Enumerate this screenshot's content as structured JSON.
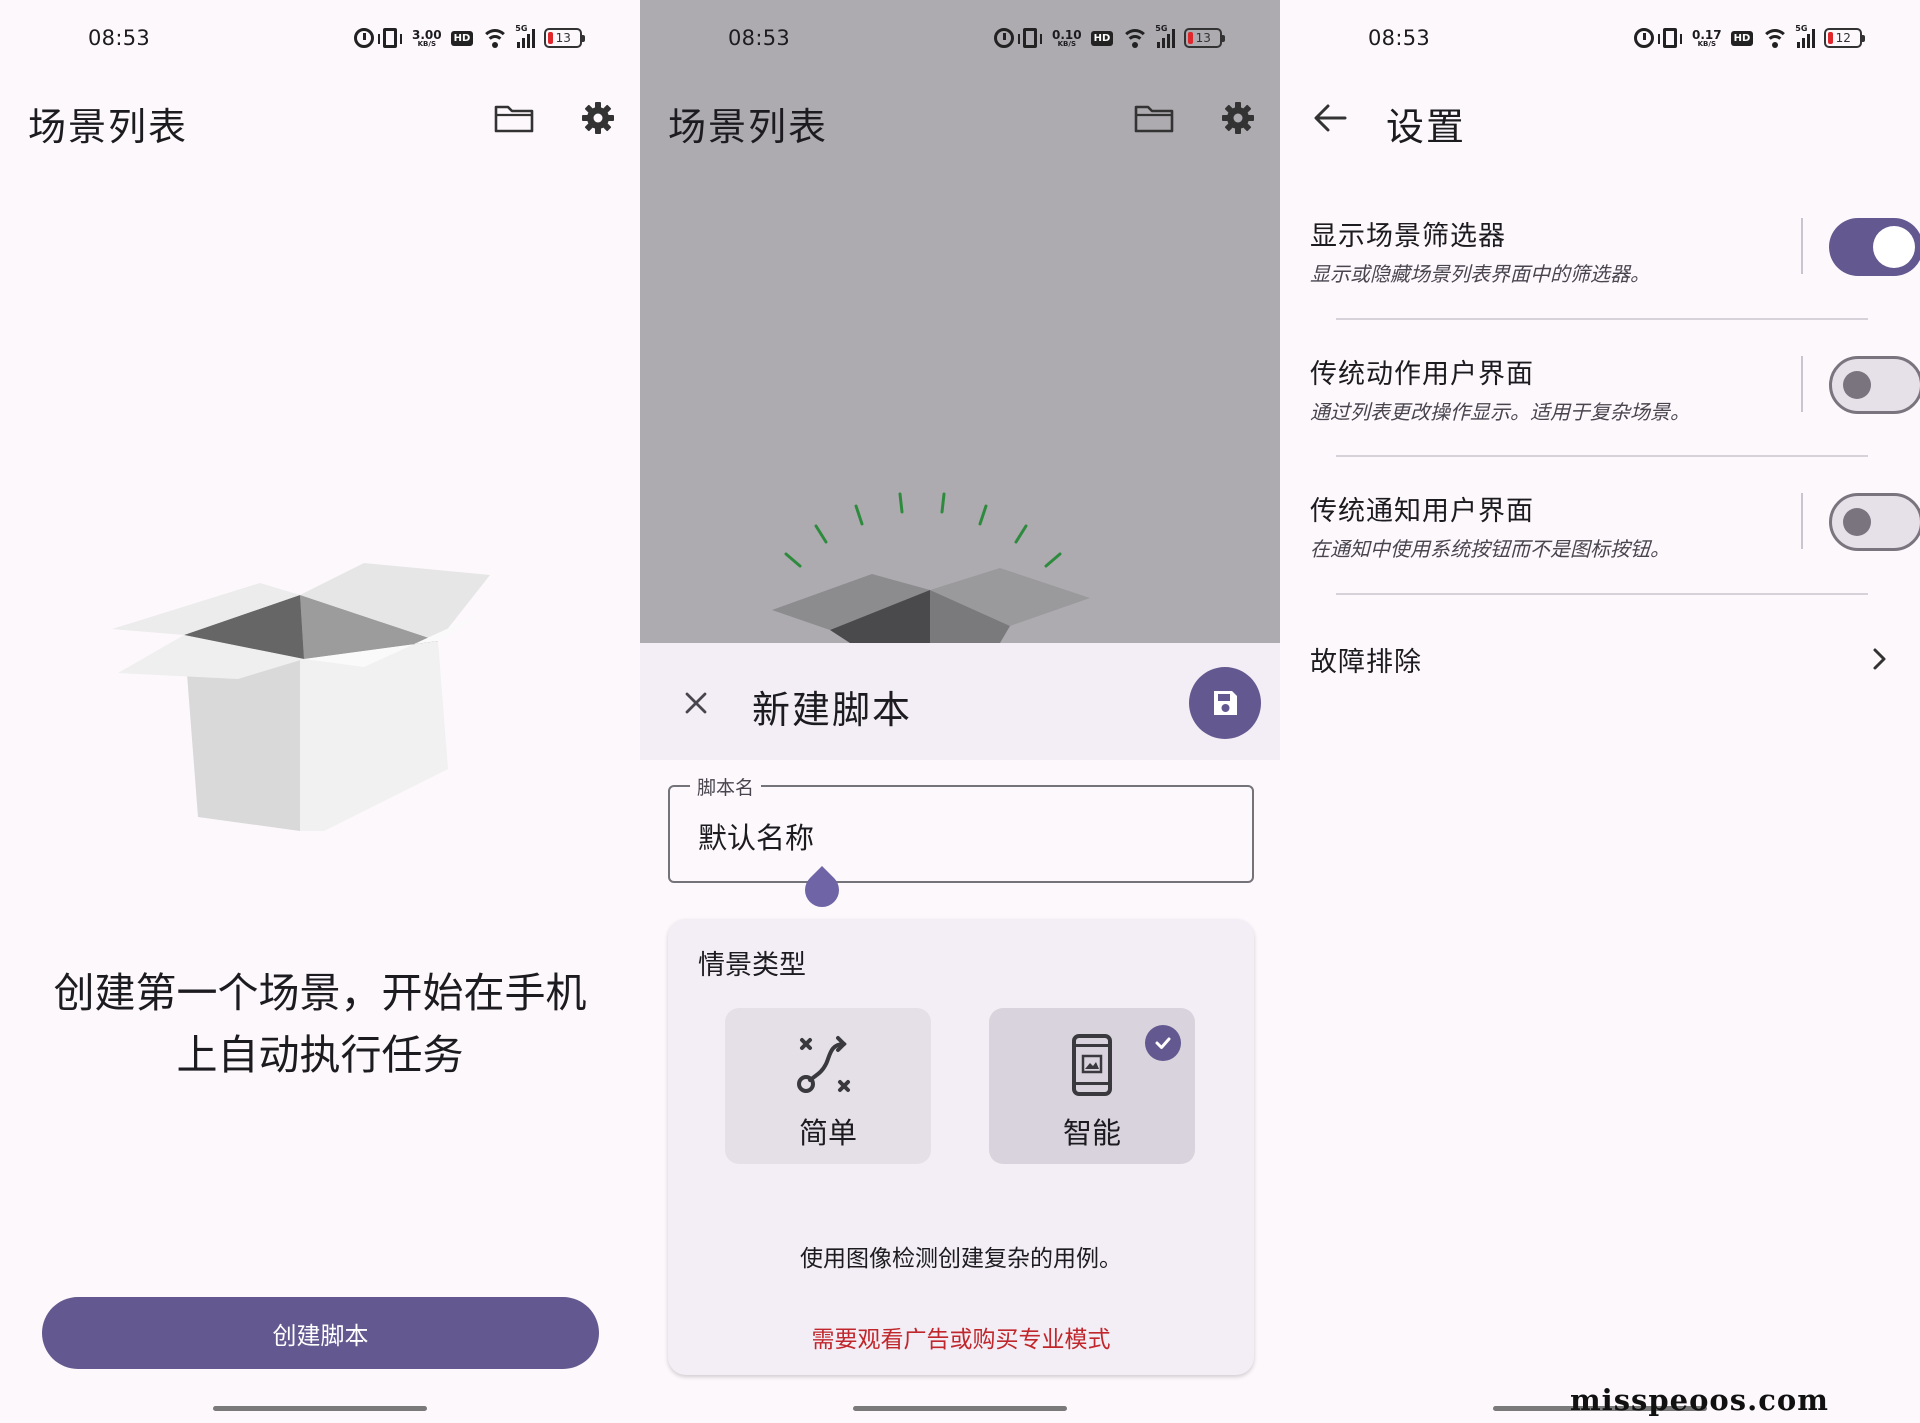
{
  "status_bar": [
    {
      "time": "08:53",
      "speed": "3.00",
      "speed_unit": "KB/S",
      "hd": "HD",
      "network": "5G",
      "battery": "13"
    },
    {
      "time": "08:53",
      "speed": "0.10",
      "speed_unit": "KB/S",
      "hd": "HD",
      "network": "5G",
      "battery": "13"
    },
    {
      "time": "08:53",
      "speed": "0.17",
      "speed_unit": "KB/S",
      "hd": "HD",
      "network": "5G",
      "battery": "12"
    }
  ],
  "scene_list": {
    "title": "场景列表",
    "empty_message_line1": "创建第一个场景，开始在手机",
    "empty_message_line2": "上自动执行任务",
    "create_button": "创建脚本",
    "icons": [
      "folder-icon",
      "gear-icon",
      "empty-box-illustration"
    ]
  },
  "new_script": {
    "background_title": "场景列表",
    "title": "新建脚本",
    "name_field": {
      "label": "脚本名",
      "value": "默认名称"
    },
    "type_card": {
      "title": "情景类型",
      "options": [
        {
          "label": "简单",
          "icon": "route-icon",
          "selected": false
        },
        {
          "label": "智能",
          "icon": "phone-image-icon",
          "selected": true
        }
      ],
      "description": "使用图像检测创建复杂的用例。",
      "warning": "需要观看广告或购买专业模式"
    },
    "icons": [
      "close-icon",
      "save-icon"
    ]
  },
  "settings": {
    "title": "设置",
    "items": [
      {
        "title": "显示场景筛选器",
        "description": "显示或隐藏场景列表界面中的筛选器。",
        "enabled": true
      },
      {
        "title": "传统动作用户界面",
        "description": "通过列表更改操作显示。适用于复杂场景。",
        "enabled": false
      },
      {
        "title": "传统通知用户界面",
        "description": "在通知中使用系统按钮而不是图标按钮。",
        "enabled": false
      }
    ],
    "troubleshooting": "故障排除",
    "watermark": "misspeoos.com"
  },
  "colors": {
    "primary": "#63588f",
    "warning": "#c0272c",
    "surface": "#fdf8fc",
    "scrim": "#aeabb0"
  }
}
